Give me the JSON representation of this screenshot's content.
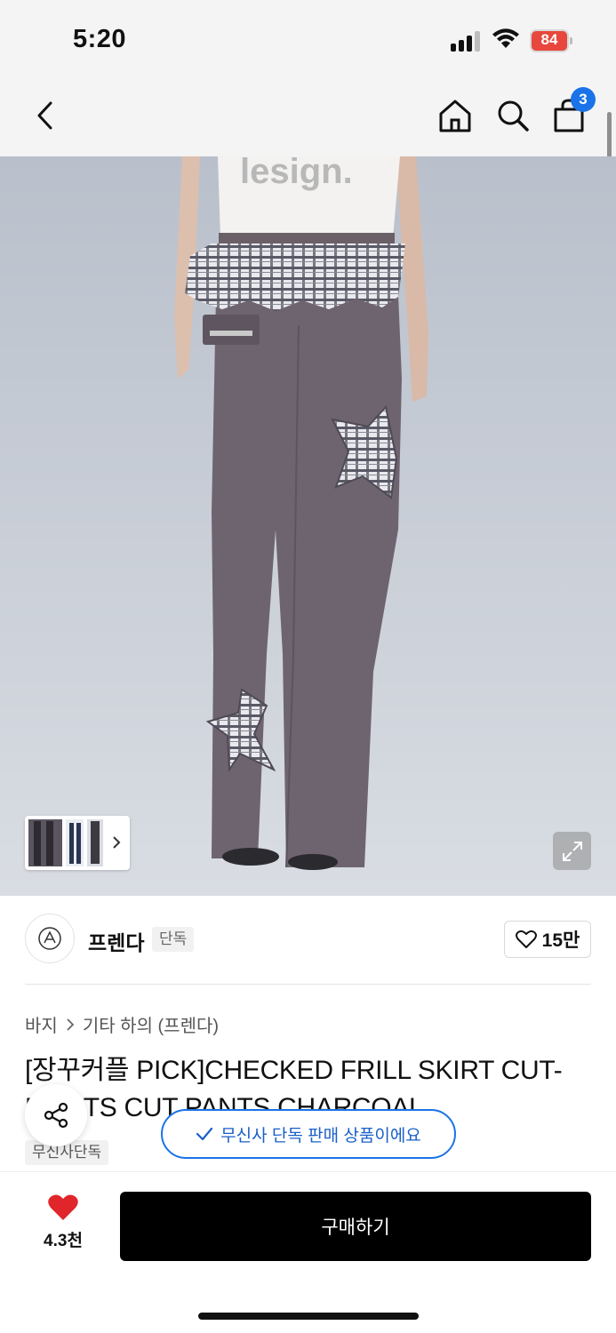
{
  "status_bar": {
    "time": "5:20",
    "battery": "84"
  },
  "nav": {
    "cart_count": "3"
  },
  "brand": {
    "name": "프렌다",
    "exclusive_label": "단독",
    "likes": "15만"
  },
  "breadcrumb": {
    "category": "바지",
    "subcategory": "기타 하의 (프렌다)"
  },
  "product": {
    "title": "[장꾸커플 PICK]CHECKED FRILL SKIRT CUT-BOOTS CUT PANTS CHARCOAL",
    "tag": "무신사단독"
  },
  "toast": {
    "text": "무신사 단독 판매 상품이에요"
  },
  "bottom": {
    "wish_count": "4.3천",
    "buy_label": "구매하기"
  },
  "colors": {
    "accent": "#1a73e8",
    "heart": "#e0262a",
    "buy_button": "#000000"
  }
}
